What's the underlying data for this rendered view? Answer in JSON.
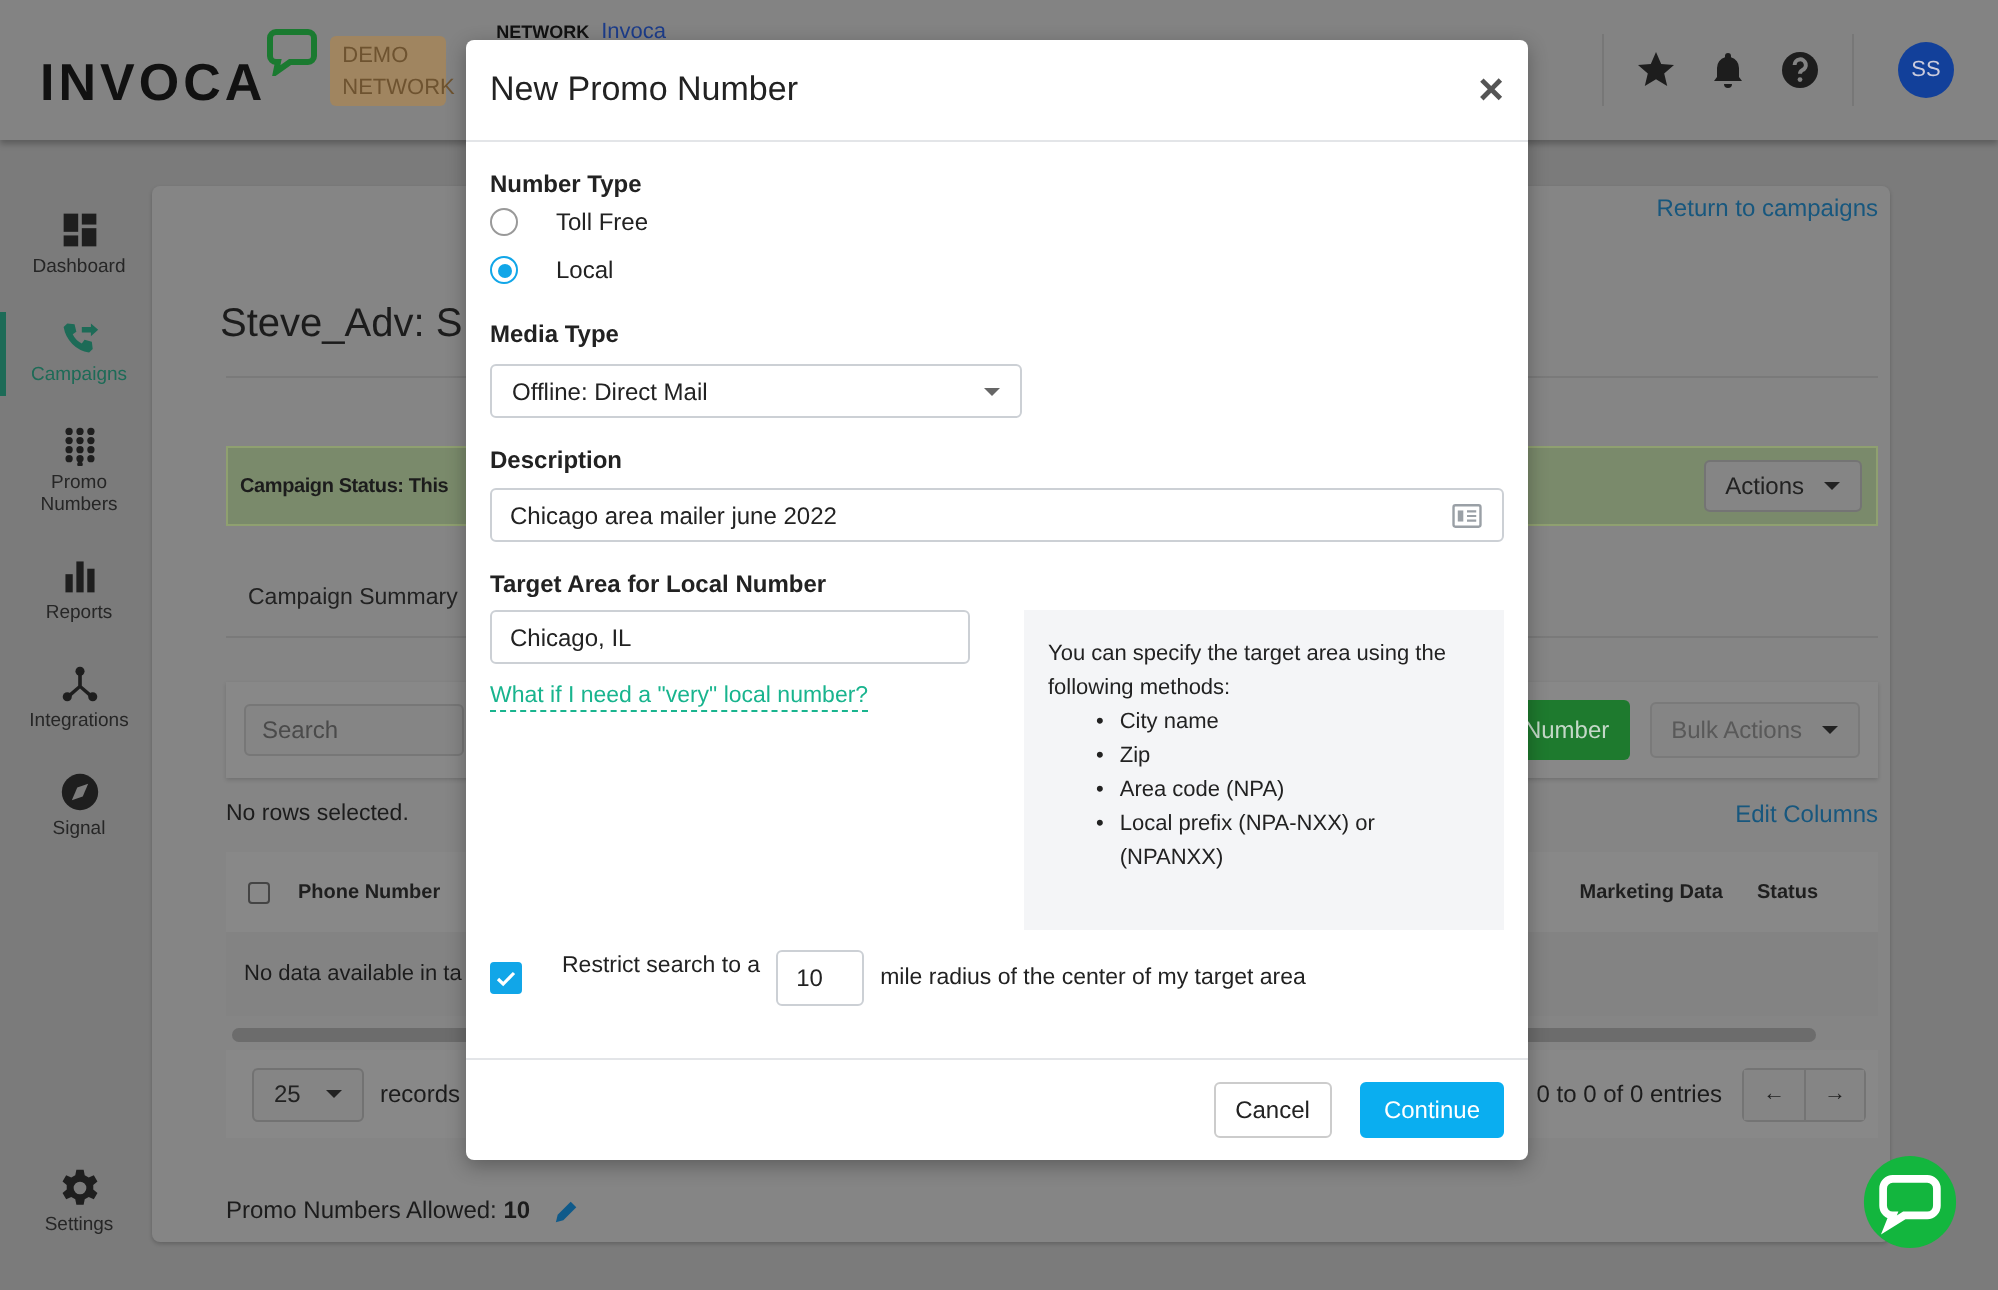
{
  "header": {
    "logo": "INVOCA",
    "badge": "DEMO NETWORK",
    "network_label": "NETWORK",
    "network_name": "Invoca",
    "avatar": "SS"
  },
  "sidebar": {
    "items": [
      {
        "label": "Dashboard",
        "selected": false
      },
      {
        "label": "Campaigns",
        "selected": true
      },
      {
        "label": "Promo Numbers",
        "selected": false
      },
      {
        "label": "Reports",
        "selected": false
      },
      {
        "label": "Integrations",
        "selected": false
      },
      {
        "label": "Signal",
        "selected": false
      }
    ],
    "settings": {
      "label": "Settings",
      "selected": false
    }
  },
  "page": {
    "return_link": "Return to campaigns",
    "title": "Steve_Adv: S",
    "status": "Campaign Status: This",
    "actions": "Actions",
    "tab": "Campaign Summary",
    "search_placeholder": "Search",
    "add_button": "Number",
    "bulk_actions": "Bulk Actions",
    "selection_note": "No rows selected.",
    "edit_columns": "Edit Columns",
    "table": {
      "select_all_checked": false,
      "left_columns": [
        "Phone Number"
      ],
      "right_columns": [
        "Marketing Data",
        "Status"
      ],
      "empty": "No data available in ta"
    },
    "page_size": "25",
    "records": "records",
    "entries": "0 to 0 of 0 entries",
    "prev": "←",
    "next": "→",
    "allowed": "Promo Numbers Allowed:  **10**"
  },
  "modal": {
    "title": "New Promo Number",
    "close": "×",
    "number_type": {
      "label": "Number Type",
      "options": [
        {
          "label": "Toll Free",
          "selected": false
        },
        {
          "label": "Local",
          "selected": true
        }
      ]
    },
    "media_type": {
      "label": "Media Type",
      "value": "Offline: Direct Mail"
    },
    "description": {
      "label": "Description",
      "value": "Chicago area mailer june 2022"
    },
    "target_area": {
      "label": "Target Area for Local Number",
      "value": "Chicago, IL",
      "help_link": "What if I need a \"very\" local number?",
      "info": {
        "text": "You can specify the target area using the following methods:",
        "items": [
          {
            "bullet": "•",
            "text": "City name"
          },
          {
            "bullet": "•",
            "text": "Zip"
          },
          {
            "bullet": "•",
            "text": "Area code (NPA)"
          },
          {
            "bullet": "•",
            "text": "Local prefix (NPA-NXX) or (NPANXX)"
          }
        ]
      }
    },
    "restrict": {
      "checked": true,
      "before": "Restrict search to a",
      "radius": "10",
      "after": "mile radius of the center of my target area"
    },
    "buttons": [
      {
        "label": "Cancel",
        "kind": "secondary"
      },
      {
        "label": "Continue",
        "kind": "primary"
      }
    ]
  }
}
